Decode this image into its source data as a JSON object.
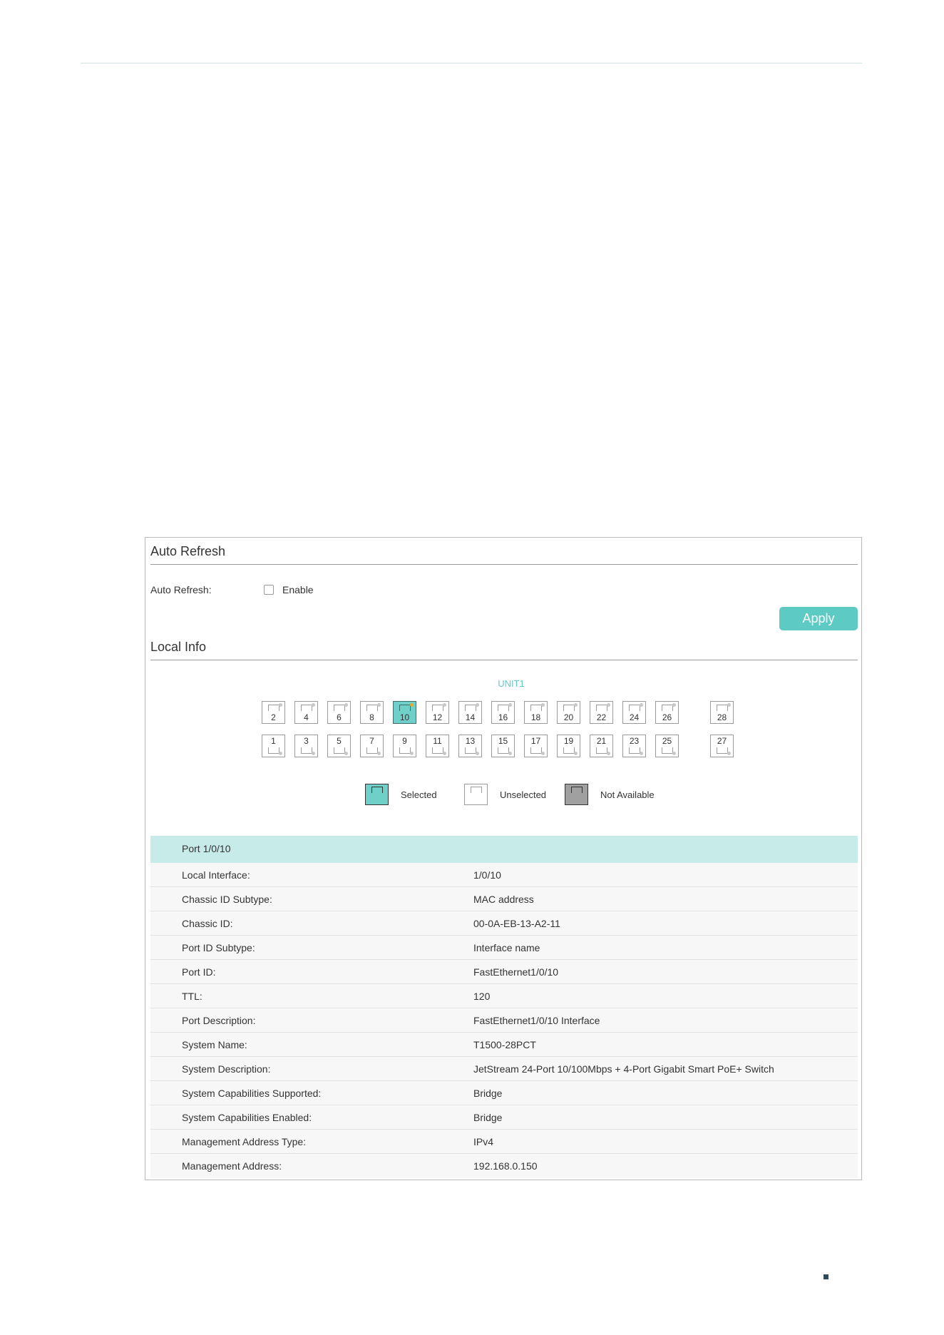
{
  "auto_refresh": {
    "section_title": "Auto Refresh",
    "field_label": "Auto Refresh:",
    "checkbox_label": "Enable",
    "checked": false,
    "apply_label": "Apply"
  },
  "local_info": {
    "section_title": "Local Info",
    "unit_label": "UNIT1",
    "ports_top": [
      "2",
      "4",
      "6",
      "8",
      "10",
      "12",
      "14",
      "16",
      "18",
      "20",
      "22",
      "24",
      "26",
      "28"
    ],
    "ports_bottom": [
      "1",
      "3",
      "5",
      "7",
      "9",
      "11",
      "13",
      "15",
      "17",
      "19",
      "21",
      "23",
      "25",
      "27"
    ],
    "selected_port": "10",
    "legend": {
      "selected": "Selected",
      "unselected": "Unselected",
      "not_available": "Not Available"
    },
    "colors": {
      "accent": "#5dcac4",
      "selected_fill": "#6fcfc9",
      "header_band": "#c7ebe8",
      "not_available": "#a0a0a0",
      "link_led": "#f5a623"
    }
  },
  "port_info": {
    "header": "Port 1/0/10",
    "rows": [
      {
        "label": "Local Interface:",
        "value": "1/0/10"
      },
      {
        "label": "Chassic ID Subtype:",
        "value": "MAC address"
      },
      {
        "label": "Chassic ID:",
        "value": "00-0A-EB-13-A2-11"
      },
      {
        "label": "Port ID Subtype:",
        "value": "Interface name"
      },
      {
        "label": "Port ID:",
        "value": "FastEthernet1/0/10"
      },
      {
        "label": "TTL:",
        "value": "120"
      },
      {
        "label": "Port Description:",
        "value": "FastEthernet1/0/10 Interface"
      },
      {
        "label": "System Name:",
        "value": "T1500-28PCT"
      },
      {
        "label": "System Description:",
        "value": "JetStream 24-Port 10/100Mbps + 4-Port Gigabit Smart PoE+ Switch"
      },
      {
        "label": "System Capabilities Supported:",
        "value": "Bridge"
      },
      {
        "label": "System Capabilities Enabled:",
        "value": "Bridge"
      },
      {
        "label": "Management Address Type:",
        "value": "IPv4"
      },
      {
        "label": "Management Address:",
        "value": "192.168.0.150"
      }
    ]
  }
}
